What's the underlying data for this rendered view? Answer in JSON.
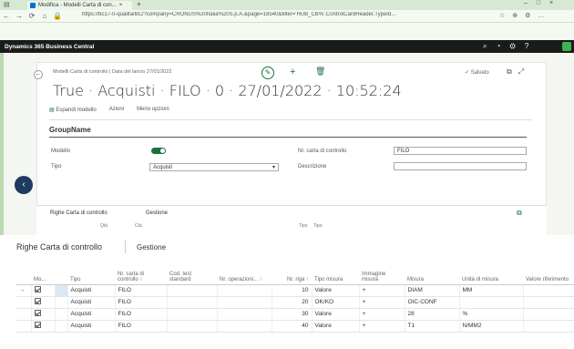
{
  "browser": {
    "tab_title": "Modifica - Modelli Carta di con...",
    "tab_close": "×",
    "new_tab": "+",
    "url": "https://bc17-0-qualita/BC/?company=CRONUS%20Italia%20S.p.A.&page=18540&filter='HUB_CB%'.ControlCardHeader.TypeId...",
    "window_controls": [
      "–",
      "□",
      "×"
    ]
  },
  "app": {
    "name": "Dynamics 365 Business Central"
  },
  "header": {
    "breadcrumb": "Modelli Carta di controllo | Data del lancio 27/01/2022",
    "saved_status": "✓ Salvato",
    "title": "True · Acquisti · FILO · 0 · 27/01/2022 · 10:52:24",
    "actions": [
      "Espandi modello",
      "Azioni",
      "Meno opzioni"
    ]
  },
  "group": {
    "name": "GroupName",
    "fields": [
      {
        "label": "Modello",
        "value": "toggle-on"
      },
      {
        "label": "Tipo",
        "value": "Acquisti"
      },
      {
        "label": "Nr. carta di controllo",
        "value": "FILO"
      },
      {
        "label": "Descrizione",
        "value": ""
      }
    ]
  },
  "lines_small": {
    "title": "Righe Carta di controllo",
    "manage": "Gestione",
    "cols": [
      "Qtà",
      "Ctà",
      "Tipo",
      "Tipo"
    ]
  },
  "lines": {
    "title": "Righe Carta di controllo",
    "manage": "Gestione",
    "columns": [
      "Mo...",
      "Tipo",
      "Nr. carta di controllo ↑",
      "Cod. test standard",
      "Nr. operazioni... ↑",
      "Nr. riga ↑",
      "Tipo misura",
      "Immagine misura",
      "Misura",
      "Unità di misura",
      "Valore riferimento"
    ],
    "rows": [
      {
        "type": "Acquisti",
        "card": "FILO",
        "line": "10",
        "meas_type": "Valore",
        "img": "+",
        "measure": "DIAM",
        "uom": "MM"
      },
      {
        "type": "Acquisti",
        "card": "FILO",
        "line": "20",
        "meas_type": "OK/KO",
        "img": "+",
        "measure": "OIC-CONF",
        "uom": ""
      },
      {
        "type": "Acquisti",
        "card": "FILO",
        "line": "30",
        "meas_type": "Valore",
        "img": "+",
        "measure": "28",
        "uom": "%"
      },
      {
        "type": "Acquisti",
        "card": "FILO",
        "line": "40",
        "meas_type": "Valore",
        "img": "+",
        "measure": "T1",
        "uom": "N/MM2"
      }
    ]
  },
  "colors": {
    "brand": "#1d6f42",
    "accent": "#008489",
    "chrome": "#d7e9d3"
  }
}
